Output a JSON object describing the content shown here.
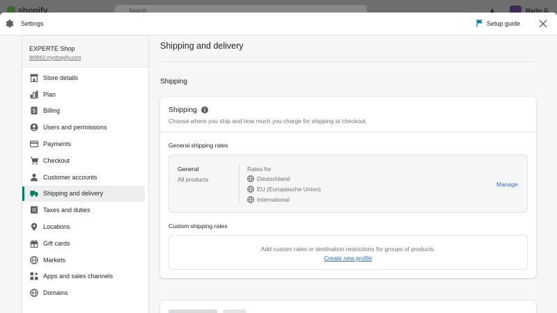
{
  "background": {
    "logo_text": "shopify",
    "search_placeholder": "Search",
    "user_name": "Martin G"
  },
  "header": {
    "title": "Settings",
    "setup_guide": "Setup guide",
    "close_icon": "close-icon",
    "settings_icon": "gear-icon",
    "flag_icon": "flag-icon"
  },
  "sidebar": {
    "store_name": "EXPERTE Shop",
    "store_domain": "96f662.myshopify.com",
    "items": [
      {
        "label": "Store details",
        "icon": "store-icon"
      },
      {
        "label": "Plan",
        "icon": "plan-icon"
      },
      {
        "label": "Billing",
        "icon": "billing-icon"
      },
      {
        "label": "Users and permissions",
        "icon": "user-circle-icon"
      },
      {
        "label": "Payments",
        "icon": "credit-card-icon"
      },
      {
        "label": "Checkout",
        "icon": "cart-icon"
      },
      {
        "label": "Customer accounts",
        "icon": "person-icon"
      },
      {
        "label": "Shipping and delivery",
        "icon": "truck-icon",
        "active": true
      },
      {
        "label": "Taxes and duties",
        "icon": "tax-icon"
      },
      {
        "label": "Locations",
        "icon": "location-pin-icon"
      },
      {
        "label": "Gift cards",
        "icon": "gift-icon"
      },
      {
        "label": "Markets",
        "icon": "globe-icon"
      },
      {
        "label": "Apps and sales channels",
        "icon": "apps-icon"
      },
      {
        "label": "Domains",
        "icon": "globe-icon"
      }
    ]
  },
  "main": {
    "page_title": "Shipping and delivery",
    "section_label": "Shipping",
    "card": {
      "title": "Shipping",
      "subtitle": "Choose where you ship and how much you charge for shipping at checkout.",
      "general_rates_label": "General shipping rates",
      "rate_box": {
        "name": "General",
        "products": "All products",
        "rates_for": "Rates for",
        "zones": [
          "Deutschland",
          "EU (Europäische Union)",
          "International"
        ],
        "manage": "Manage"
      },
      "custom_rates_label": "Custom shipping rates",
      "custom_rates_text": "Add custom rates or destination restrictions for groups of products.",
      "create_profile": "Create new profile"
    }
  },
  "colors": {
    "accent_green": "#008060",
    "link_blue": "#2c6ecb",
    "flag_teal": "#0e7ea5"
  }
}
